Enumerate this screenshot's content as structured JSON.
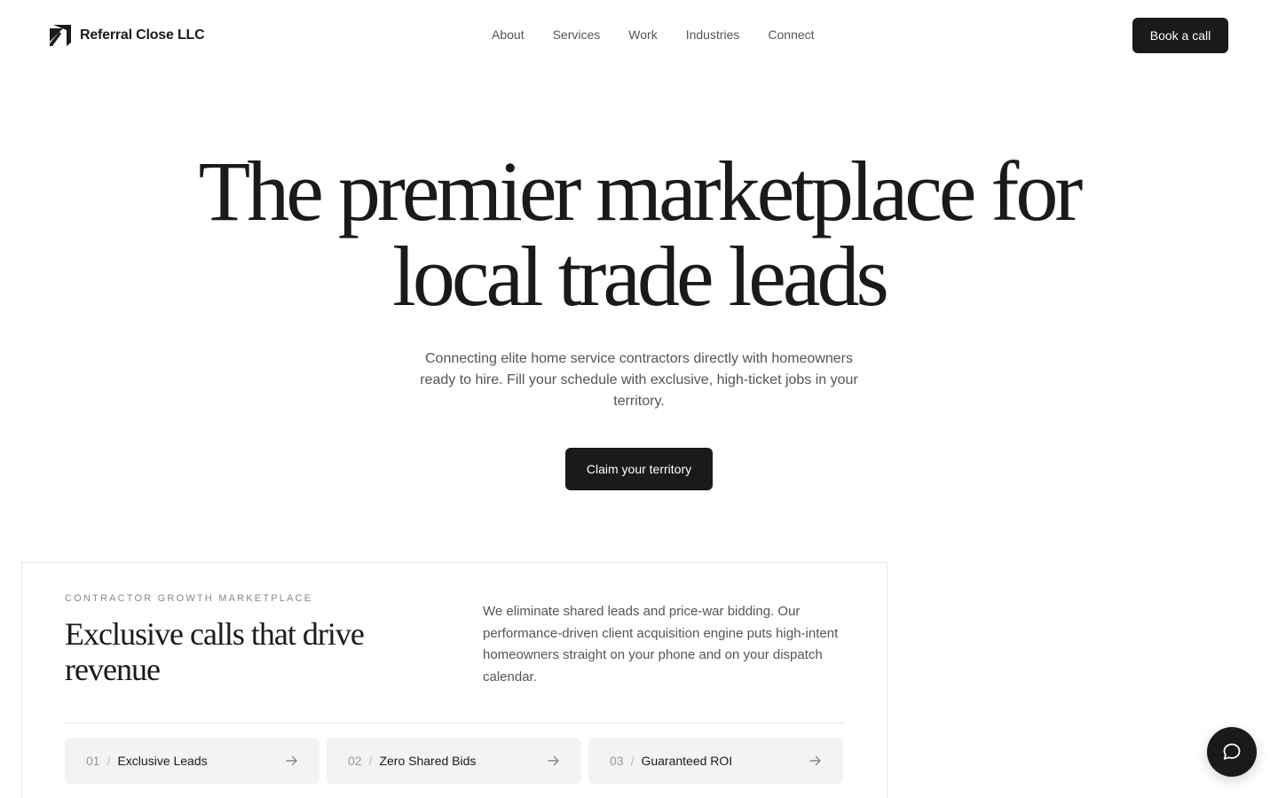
{
  "brand": {
    "name": "Referral Close LLC",
    "logo_icon": "diagonal-arrow-logo-icon"
  },
  "nav": {
    "items": [
      "About",
      "Services",
      "Work",
      "Industries",
      "Connect"
    ]
  },
  "header": {
    "cta_label": "Book a call"
  },
  "hero": {
    "title_line1": "The premier marketplace for",
    "title_line2": "local trade leads",
    "subtitle": "Connecting elite home service contractors directly with homeowners ready to hire. Fill your schedule with exclusive, high-ticket jobs in your territory.",
    "cta_label": "Claim your territory"
  },
  "card": {
    "eyebrow": "CONTRACTOR GROWTH MARKETPLACE",
    "title": "Exclusive calls that drive revenue",
    "description": "We eliminate shared leads and price-war bidding. Our performance-driven client acquisition engine puts high-intent homeowners straight on your phone and on your dispatch calendar.",
    "features": [
      {
        "num": "01",
        "sep": "/",
        "label": "Exclusive Leads"
      },
      {
        "num": "02",
        "sep": "/",
        "label": "Zero Shared Bids"
      },
      {
        "num": "03",
        "sep": "/",
        "label": "Guaranteed ROI"
      }
    ]
  },
  "chat": {
    "icon": "chat-bubble-icon"
  },
  "colors": {
    "primary": "#1a1a1a",
    "text_muted": "#555555",
    "card_bg": "#f3f3f3",
    "border": "#e6e6e6"
  }
}
